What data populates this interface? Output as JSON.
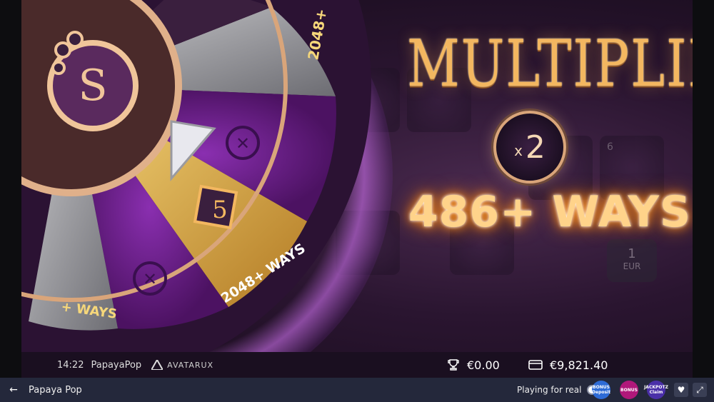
{
  "multiplier": {
    "title": "MULTIPLIER",
    "x_prefix": "x",
    "value": "2"
  },
  "ways_text": "486+ WAYS",
  "wheel": {
    "segments": [
      {
        "label": "2048+",
        "kind": "text"
      },
      {
        "label": "x",
        "kind": "symbol"
      },
      {
        "label": "5",
        "kind": "multiplier"
      },
      {
        "label": "2048+ WAYS",
        "kind": "text"
      },
      {
        "label": "x",
        "kind": "symbol"
      },
      {
        "label": "+ WAYS",
        "kind": "text"
      }
    ]
  },
  "reel_labels": {
    "cell_amount": "1",
    "cell_currency": "EUR",
    "cell_number": "6"
  },
  "info_bar": {
    "time": "14:22",
    "game_name": "PapayaPop",
    "brand": "AVATARUX",
    "win": "€0.00",
    "balance": "€9,821.40"
  },
  "bottom_bar": {
    "title": "Papaya Pop",
    "playing_for_real": "Playing for real",
    "promos": [
      {
        "label": "BONUS Deposit",
        "color": "#2e6bd6"
      },
      {
        "label": "BONUS",
        "color": "#b0187a"
      },
      {
        "label": "JACKPOTZ Claim",
        "color": "#4a2fa8"
      }
    ]
  },
  "colors": {
    "gold": "#f3b760",
    "purple": "#6a1e86",
    "frame": "#d9a57a"
  }
}
